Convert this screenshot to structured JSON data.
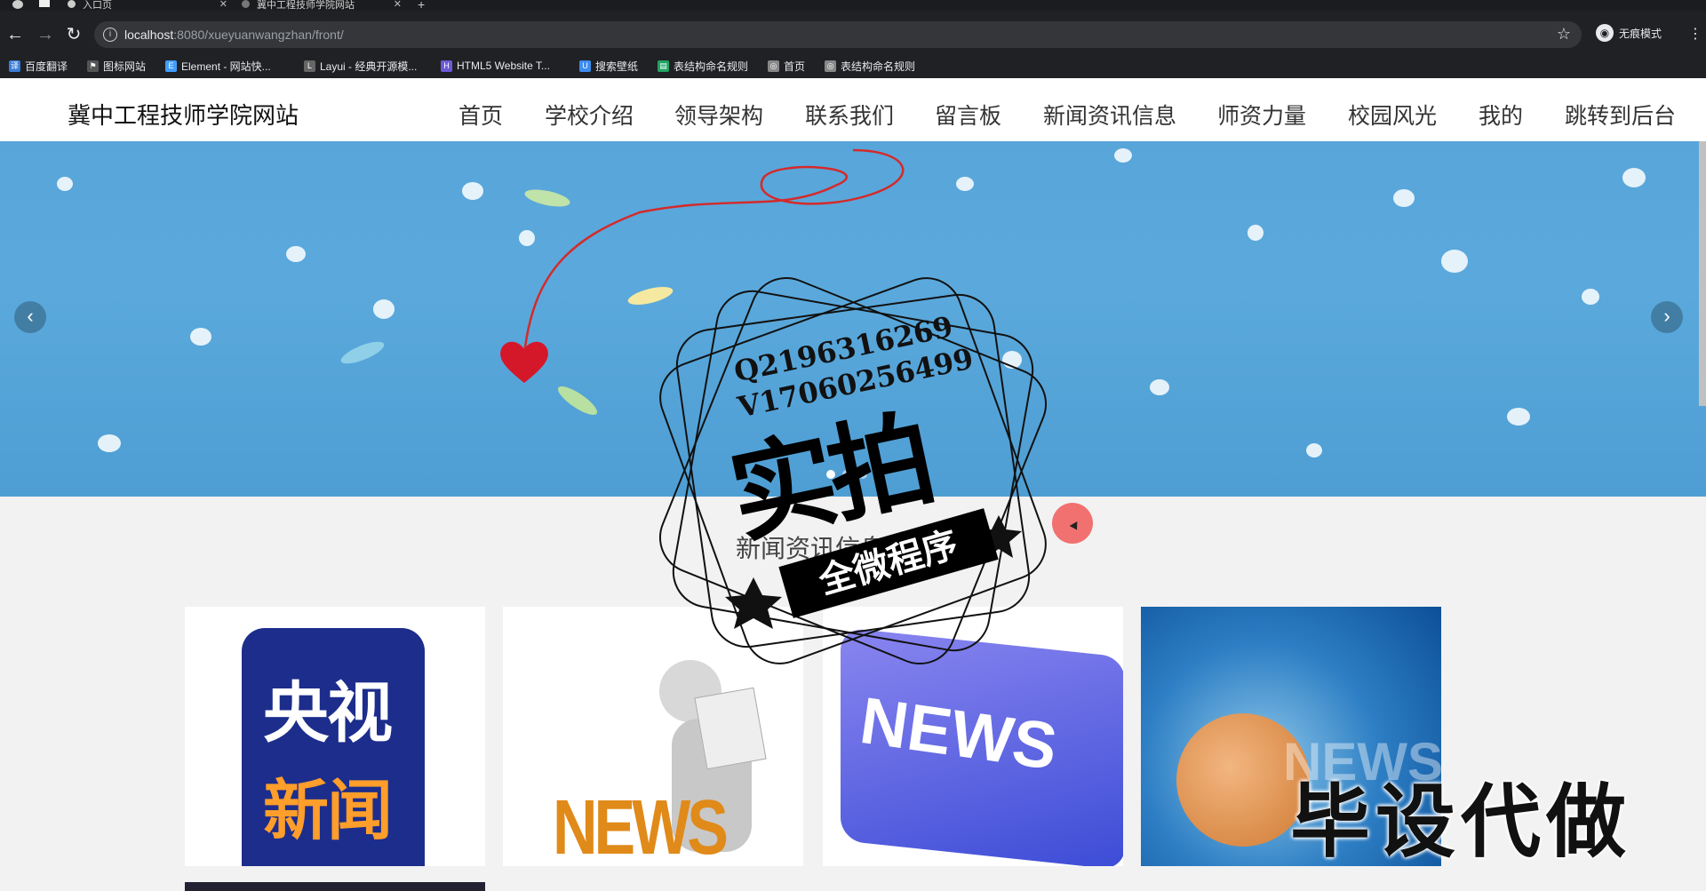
{
  "browser": {
    "tabs": [
      {
        "label": "入口页"
      },
      {
        "label": "冀中工程技师学院网站"
      }
    ],
    "url_host": "localhost",
    "url_rest": ":8080/xueyuanwangzhan/front/",
    "profile_label": "无痕模式",
    "bookmarks": [
      {
        "label": "百度翻译",
        "icon": "translate-icon",
        "color": "#3b7dd8"
      },
      {
        "label": "图标网站",
        "icon": "flag-icon",
        "color": "#555555"
      },
      {
        "label": "Element - 网站快...",
        "icon": "element-icon",
        "color": "#409eff"
      },
      {
        "label": "Layui - 经典开源模...",
        "icon": "layui-icon",
        "color": "#666666"
      },
      {
        "label": "HTML5 Website T...",
        "icon": "html5-icon",
        "color": "#6b5bd8"
      },
      {
        "label": "搜索壁纸",
        "icon": "wallpaper-icon",
        "color": "#3c8df0"
      },
      {
        "label": "表结构命名规则",
        "icon": "sheet-icon",
        "color": "#1fa463"
      },
      {
        "label": "首页",
        "icon": "globe-icon",
        "color": "#888888"
      },
      {
        "label": "表结构命名规则",
        "icon": "globe-icon",
        "color": "#888888"
      }
    ]
  },
  "site": {
    "title": "冀中工程技师学院网站",
    "nav": [
      "首页",
      "学校介绍",
      "领导架构",
      "联系我们",
      "留言板",
      "新闻资讯信息",
      "师资力量",
      "校园风光",
      "我的",
      "跳转到后台"
    ]
  },
  "section": {
    "title": "新闻资讯信息"
  },
  "cards": [
    {
      "image_text_1": "央视",
      "image_text_2": "新闻"
    },
    {
      "image_text": "NEWS"
    },
    {
      "image_text": "NEWS"
    },
    {
      "image_text": "NEWS"
    }
  ],
  "watermark": {
    "q": "Q2196316269",
    "v": "V17060256499",
    "big": "实拍",
    "ribbon": "全微程序",
    "bottom": "毕设代做"
  }
}
